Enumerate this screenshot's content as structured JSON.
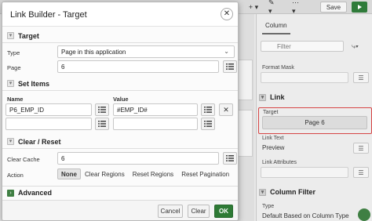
{
  "background": {
    "toolbar": {
      "save_label": "Save",
      "plus_label": "+ ▾",
      "wrench_label": "✎ ▾",
      "more_label": "⋯ ▾"
    },
    "panel": {
      "tab_label": "Column",
      "search_placeholder": "Filter",
      "format_mask_label": "Format Mask",
      "link_section": "Link",
      "target_label": "Target",
      "target_value": "Page 6",
      "link_text_label": "Link Text",
      "link_text_value": "Preview",
      "link_attributes_label": "Link Attributes",
      "column_filter_section": "Column Filter",
      "type_label": "Type",
      "type_value": "Default Based on Column Type"
    }
  },
  "dialog": {
    "title": "Link Builder - Target",
    "close_icon": "close-icon",
    "target_section": {
      "heading": "Target",
      "type_label": "Type",
      "type_value": "Page in this application",
      "page_label": "Page",
      "page_value": "6"
    },
    "set_items_section": {
      "heading": "Set Items",
      "name_header": "Name",
      "value_header": "Value",
      "rows": [
        {
          "name": "P6_EMP_ID",
          "value": "#EMP_ID#"
        },
        {
          "name": "",
          "value": ""
        }
      ]
    },
    "clear_reset_section": {
      "heading": "Clear / Reset",
      "clear_cache_label": "Clear Cache",
      "clear_cache_value": "6",
      "action_label": "Action",
      "actions": [
        "None",
        "Clear Regions",
        "Reset Regions",
        "Reset Pagination"
      ],
      "selected_action": "None"
    },
    "advanced_section": {
      "heading": "Advanced"
    },
    "footer": {
      "cancel_label": "Cancel",
      "clear_label": "Clear",
      "ok_label": "OK"
    }
  },
  "colors": {
    "ok_green": "#2e7a35",
    "highlight_red": "#d64545"
  }
}
